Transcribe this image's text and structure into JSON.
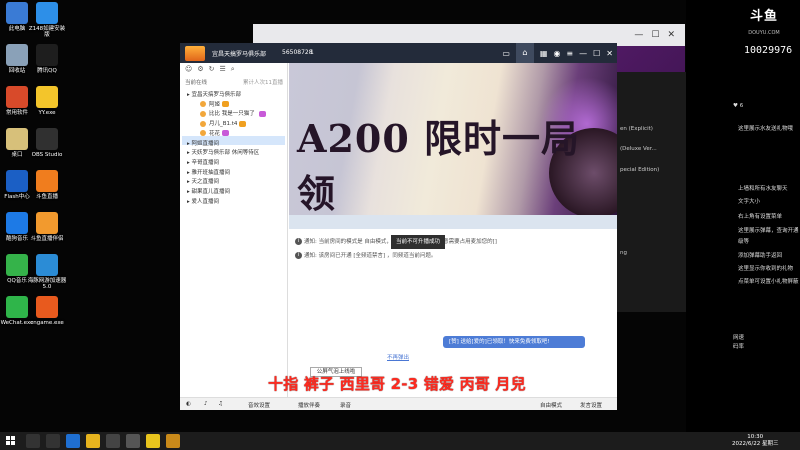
{
  "desktop": {
    "icons": [
      {
        "label": "此电脑",
        "color": "#3a7bd5"
      },
      {
        "label": "Z148如建安装版",
        "color": "#2d8fe8"
      },
      {
        "label": "回收站",
        "color": "#8aa1b8"
      },
      {
        "label": "腾讯QQ",
        "color": "#1e1e1e"
      },
      {
        "label": "常用软件",
        "color": "#d84a2a"
      },
      {
        "label": "YY.exe",
        "color": "#f3c52b"
      },
      {
        "label": "桌口",
        "color": "#d7c07a"
      },
      {
        "label": "OBS Studio",
        "color": "#303030"
      },
      {
        "label": "Flash中心",
        "color": "#1b5fc5"
      },
      {
        "label": "斗鱼直播",
        "color": "#f07d1e"
      },
      {
        "label": "酷狗音乐",
        "color": "#1d7ae6"
      },
      {
        "label": "斗鱼直播伴侣",
        "color": "#f29a2e"
      },
      {
        "label": "QQ音乐",
        "color": "#35b34a"
      },
      {
        "label": "海豚网游加速器5.0",
        "color": "#2b8cd6"
      },
      {
        "label": "WeChat.exe",
        "color": "#2fb54a"
      },
      {
        "label": "cngame.exe",
        "color": "#e85a1e"
      }
    ]
  },
  "right_panel": {
    "logo": "斗鱼",
    "logo_sub": "DOUYU.COM",
    "room_id": "10029976",
    "likes": "6",
    "messages": [
      "这里展示水友送礼物哦",
      "上墙和所有水友聊天",
      "文字大小",
      "右上角有设置菜单",
      "这里展示弹幕，查询开通",
      "级等",
      "添加弹幕助手返回",
      "这里显示你收到的礼物",
      "点菜单可设置小礼物屏蔽",
      "网速 ",
      "码率 "
    ]
  },
  "bg_window": {
    "items": [
      "en (Explicit)",
      "(Deluxe Ver...",
      "pecial Edition)",
      "ng"
    ]
  },
  "main": {
    "title": "宜昌天搞罗马俱乐部",
    "channel_id": "56508728",
    "user_count": "1",
    "sidebar": {
      "online_label": "当前在线",
      "total_label": "累计人次11直播",
      "channels": [
        {
          "label": "宜昌天搞罗马俱乐部",
          "kind": "main"
        },
        {
          "label": "阿姬",
          "kind": "user"
        },
        {
          "label": "比比  我是一只猫了 ",
          "kind": "user"
        },
        {
          "label": "月儿_B1.t4",
          "kind": "user",
          "selected": true
        },
        {
          "label": "花花",
          "kind": "user"
        },
        {
          "label": "阿姬直播间",
          "kind": "sub"
        },
        {
          "label": "天妖罗马俱乐部  休闲等待区",
          "kind": "sub"
        },
        {
          "label": "辛哥直播间",
          "kind": "sub"
        },
        {
          "label": "雅开班抽直播间",
          "kind": "sub"
        },
        {
          "label": "天之直播间",
          "kind": "sub"
        },
        {
          "label": "甜果直儿直播间",
          "kind": "sub"
        },
        {
          "label": "爱人直播间",
          "kind": "sub"
        }
      ]
    },
    "banner_text": "A200 限时一局领",
    "chat": {
      "lines": [
        "通知:  当前房间的模式是 自由模式，你可以自由发言。 同意需要占用麦加您的[]",
        "通知:  该房间已开通 [全频道禁言] ，同频道当前问题。"
      ],
      "tooltip": "当前不可升播成功",
      "bubble": "[赞] 送给[爱的]已领取！快来免费领取吧!",
      "no_remind": "不再弹出",
      "public_tip": "公屏气泡上线啦"
    },
    "danmu": "十指 裤子 西里哥 2-3 错爱 丙哥 月兒",
    "bottom": {
      "voice": "音效设置",
      "music": "播放伴奏",
      "record": "录音",
      "mode": "自由模式",
      "settings": "发言设置"
    }
  },
  "taskbar": {
    "time": "10:30",
    "date": "2022/6/22 星期三"
  }
}
